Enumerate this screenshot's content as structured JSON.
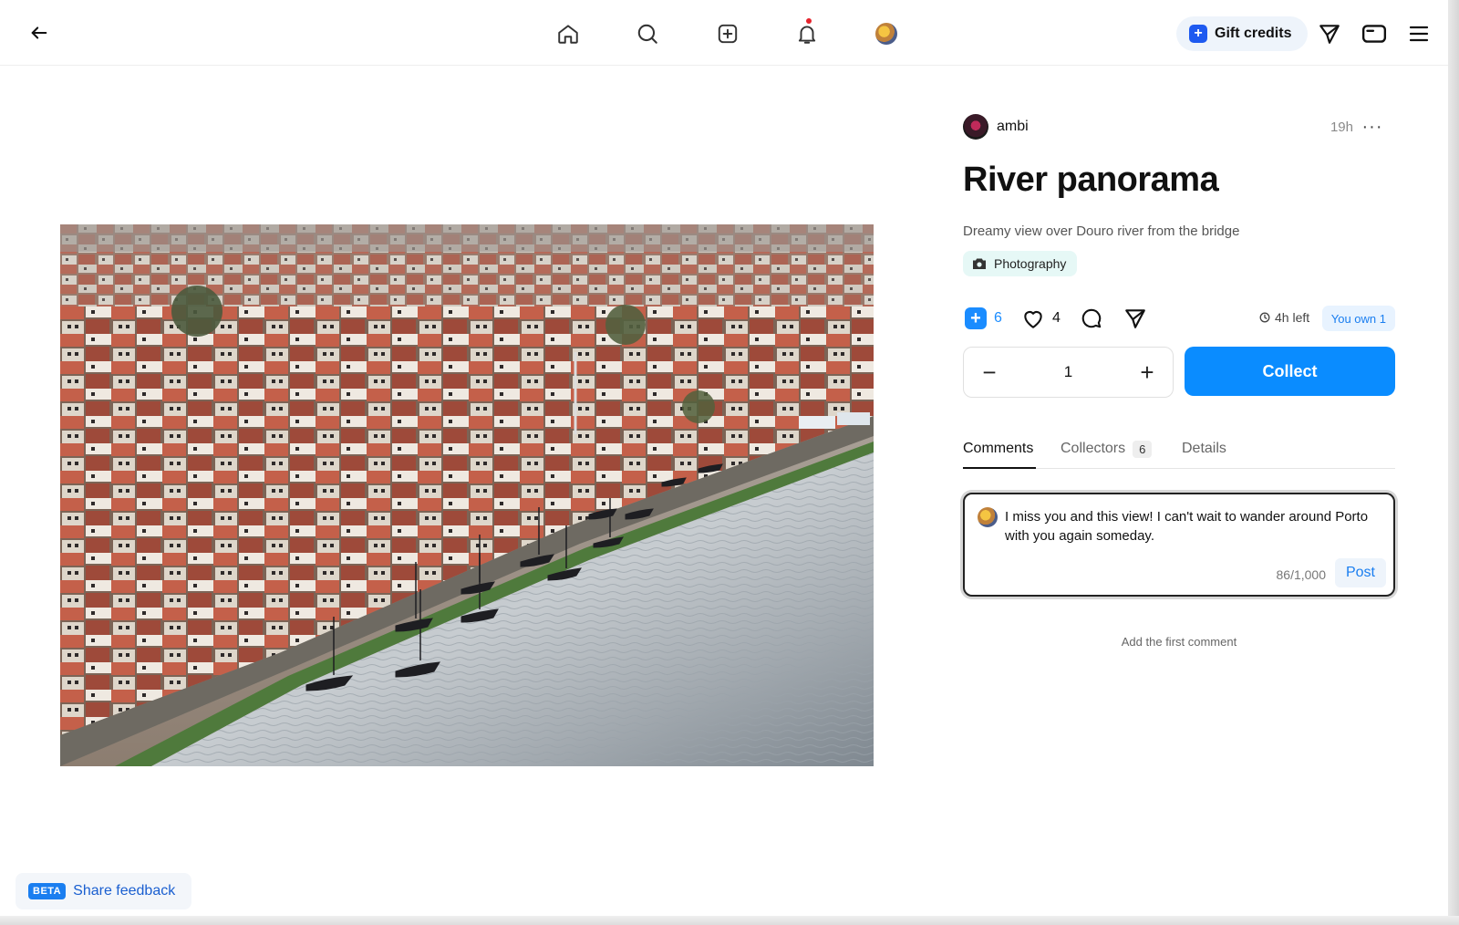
{
  "topbar": {
    "back_icon": "arrow-left-icon",
    "nav": [
      {
        "name": "home",
        "icon": "home-icon"
      },
      {
        "name": "search",
        "icon": "search-icon"
      },
      {
        "name": "create",
        "icon": "plus-square-icon"
      },
      {
        "name": "notifications",
        "icon": "bell-icon",
        "has_dot": true
      },
      {
        "name": "profile",
        "icon": "avatar"
      }
    ],
    "gift_credits_label": "Gift credits",
    "right_icons": [
      "send-icon",
      "wallet-icon",
      "menu-icon"
    ]
  },
  "post": {
    "author": "ambi",
    "time_ago": "19h",
    "more_label": "···",
    "title": "River panorama",
    "description": "Dreamy view over Douro river from the bridge",
    "tag": "Photography",
    "collect_count": "6",
    "like_count": "4",
    "time_left": "4h left",
    "owned": "You own 1"
  },
  "collect": {
    "quantity": "1",
    "minus": "−",
    "plus": "+",
    "button_label": "Collect"
  },
  "tabs": [
    {
      "label": "Comments",
      "active": true
    },
    {
      "label": "Collectors",
      "count": "6"
    },
    {
      "label": "Details"
    }
  ],
  "comment_box": {
    "text": "I miss you and this view! I can't wait to wander around Porto with you again someday.",
    "char_count": "86/1,000",
    "post_label": "Post"
  },
  "empty_comments": "Add the first comment",
  "feedback": {
    "badge": "BETA",
    "label": "Share feedback"
  },
  "colors": {
    "accent": "#0a8cff",
    "gift_plus": "#1e5af0",
    "notification_dot": "#e5232c",
    "tag_bg": "#e6f8f6"
  }
}
